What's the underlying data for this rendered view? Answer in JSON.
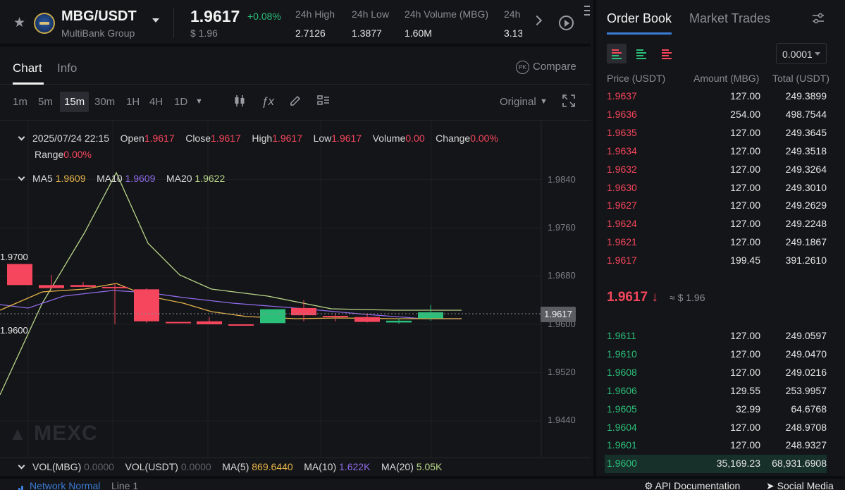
{
  "header": {
    "pair": "MBG/USDT",
    "pair_sub": "MultiBank Group",
    "price": "1.9617",
    "change": "+0.08%",
    "usd_price": "$ 1.96",
    "stats": [
      {
        "label": "24h High",
        "value": "2.7126"
      },
      {
        "label": "24h Low",
        "value": "1.3877"
      },
      {
        "label": "24h Volume (MBG)",
        "value": "1.60M"
      },
      {
        "label": "24h",
        "value": "3.13"
      }
    ]
  },
  "chart_tabs": {
    "chart": "Chart",
    "info": "Info",
    "compare": "Compare",
    "pk": "PK"
  },
  "toolbar": {
    "timeframes": [
      "1m",
      "5m",
      "15m",
      "30m",
      "1H",
      "4H",
      "1D"
    ],
    "selected": "15m",
    "original": "Original"
  },
  "ohlc": {
    "date": "2025/07/24 22:15",
    "open_label": "Open",
    "open": "1.9617",
    "close_label": "Close",
    "close": "1.9617",
    "high_label": "High",
    "high": "1.9617",
    "low_label": "Low",
    "low": "1.9617",
    "volume_label": "Volume",
    "volume": "0.00",
    "change_label": "Change",
    "change": "0.00%",
    "range_label": "Range",
    "range": "0.00%"
  },
  "ma": {
    "ma5_label": "MA5",
    "ma5": "1.9609",
    "ma10_label": "MA10",
    "ma10": "1.9609",
    "ma20_label": "MA20",
    "ma20": "1.9622"
  },
  "vol": {
    "mbg_label": "VOL(MBG)",
    "mbg": "0.0000",
    "usdt_label": "VOL(USDT)",
    "usdt": "0.0000",
    "ma5_label": "MA(5)",
    "ma5": "869.6440",
    "ma10_label": "MA(10)",
    "ma10": "1.622K",
    "ma20_label": "MA(20)",
    "ma20": "5.05K"
  },
  "chart_data": {
    "type": "candlestick",
    "y_axis_labels": [
      "1.9840",
      "1.9760",
      "1.9680",
      "1.9600",
      "1.9520",
      "1.9440"
    ],
    "current_price": "1.9617",
    "left_marks": [
      "1.9700",
      "1.9600"
    ],
    "candles": [
      {
        "open": 1.97,
        "close": 1.9665,
        "high": 1.97,
        "low": 1.9665
      },
      {
        "open": 1.9665,
        "close": 1.966,
        "high": 1.9682,
        "low": 1.966
      },
      {
        "open": 1.9665,
        "close": 1.9662,
        "high": 1.967,
        "low": 1.9662
      },
      {
        "open": 1.9662,
        "close": 1.966,
        "high": 1.9668,
        "low": 1.96
      },
      {
        "open": 1.9658,
        "close": 1.9605,
        "high": 1.966,
        "low": 1.9602
      },
      {
        "open": 1.9604,
        "close": 1.9604,
        "high": 1.9604,
        "low": 1.9602
      },
      {
        "open": 1.9605,
        "close": 1.96,
        "high": 1.9612,
        "low": 1.96
      },
      {
        "open": 1.96,
        "close": 1.96,
        "high": 1.96,
        "low": 1.9598
      },
      {
        "open": 1.9602,
        "close": 1.9625,
        "high": 1.9625,
        "low": 1.9602,
        "up": true
      },
      {
        "open": 1.9627,
        "close": 1.9615,
        "high": 1.964,
        "low": 1.9605
      },
      {
        "open": 1.9614,
        "close": 1.9612,
        "high": 1.9618,
        "low": 1.9605
      },
      {
        "open": 1.9612,
        "close": 1.9604,
        "high": 1.9618,
        "low": 1.9603
      },
      {
        "open": 1.9603,
        "close": 1.9606,
        "high": 1.961,
        "low": 1.9601,
        "up": true
      },
      {
        "open": 1.961,
        "close": 1.962,
        "high": 1.9632,
        "low": 1.9606,
        "up": true
      }
    ]
  },
  "watermark": "MEXC",
  "footer": {
    "network": "Network Normal",
    "line": "Line 1",
    "api": "API Documentation",
    "social": "Social Media"
  },
  "orderbook": {
    "tab_book": "Order Book",
    "tab_trades": "Market Trades",
    "precision": "0.0001",
    "headers": {
      "price": "Price (USDT)",
      "amount": "Amount (MBG)",
      "total": "Total (USDT)"
    },
    "asks": [
      {
        "p": "1.9637",
        "a": "127.00",
        "t": "249.3899"
      },
      {
        "p": "1.9636",
        "a": "254.00",
        "t": "498.7544"
      },
      {
        "p": "1.9635",
        "a": "127.00",
        "t": "249.3645"
      },
      {
        "p": "1.9634",
        "a": "127.00",
        "t": "249.3518"
      },
      {
        "p": "1.9632",
        "a": "127.00",
        "t": "249.3264"
      },
      {
        "p": "1.9630",
        "a": "127.00",
        "t": "249.3010"
      },
      {
        "p": "1.9627",
        "a": "127.00",
        "t": "249.2629"
      },
      {
        "p": "1.9624",
        "a": "127.00",
        "t": "249.2248"
      },
      {
        "p": "1.9621",
        "a": "127.00",
        "t": "249.1867"
      },
      {
        "p": "1.9617",
        "a": "199.45",
        "t": "391.2610"
      }
    ],
    "mid_price": "1.9617",
    "mid_arrow": "↓",
    "mid_usd": "≈ $ 1.96",
    "bids": [
      {
        "p": "1.9611",
        "a": "127.00",
        "t": "249.0597"
      },
      {
        "p": "1.9610",
        "a": "127.00",
        "t": "249.0470"
      },
      {
        "p": "1.9608",
        "a": "127.00",
        "t": "249.0216"
      },
      {
        "p": "1.9606",
        "a": "129.55",
        "t": "253.9957"
      },
      {
        "p": "1.9605",
        "a": "32.99",
        "t": "64.6768"
      },
      {
        "p": "1.9604",
        "a": "127.00",
        "t": "248.9708"
      },
      {
        "p": "1.9601",
        "a": "127.00",
        "t": "248.9327"
      },
      {
        "p": "1.9600",
        "a": "35,169.23",
        "t": "68,931.6908"
      }
    ]
  }
}
